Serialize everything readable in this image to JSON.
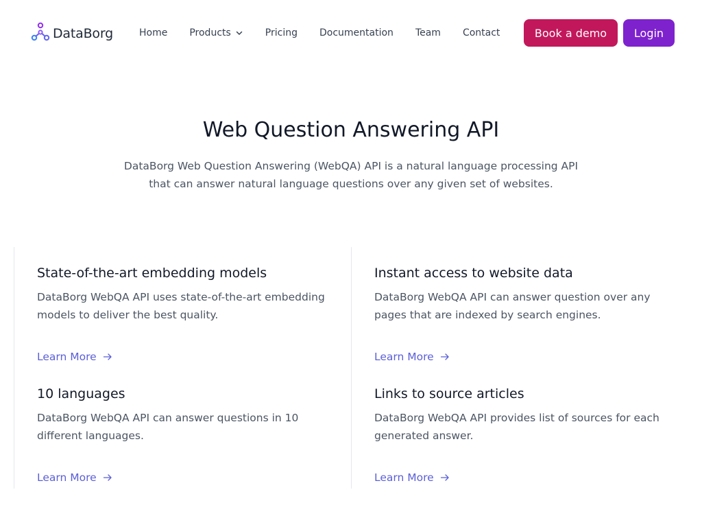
{
  "header": {
    "logo_text": "DataBorg",
    "nav": [
      {
        "label": "Home"
      },
      {
        "label": "Products",
        "has_dropdown": true
      },
      {
        "label": "Pricing"
      },
      {
        "label": "Documentation"
      },
      {
        "label": "Team"
      },
      {
        "label": "Contact"
      }
    ],
    "demo_button": "Book a demo",
    "login_button": "Login"
  },
  "hero": {
    "title": "Web Question Answering API",
    "description": "DataBorg Web Question Answering (WebQA) API is a natural language processing API that can answer natural language questions over any given set of websites."
  },
  "features": [
    {
      "title": "State-of-the-art embedding models",
      "description": "DataBorg WebQA API uses state-of-the-art embedding models to deliver the best quality.",
      "link": "Learn More"
    },
    {
      "title": "Instant access to website data",
      "description": "DataBorg WebQA API can answer question over any pages that are indexed by search engines.",
      "link": "Learn More"
    },
    {
      "title": "10 languages",
      "description": "DataBorg WebQA API can answer questions in 10 different languages.",
      "link": "Learn More"
    },
    {
      "title": "Links to source articles",
      "description": "DataBorg WebQA API provides list of sources for each generated answer.",
      "link": "Learn More"
    }
  ],
  "colors": {
    "demo_button": "#c2185b",
    "login_button": "#7e22ce",
    "link": "#5b5fd6",
    "logo_purple": "#9333ea",
    "logo_blue": "#3b82f6"
  },
  "icons": {
    "logo": "molecule-nodes-icon",
    "dropdown": "chevron-down-icon",
    "link_arrow": "arrow-right-icon"
  }
}
